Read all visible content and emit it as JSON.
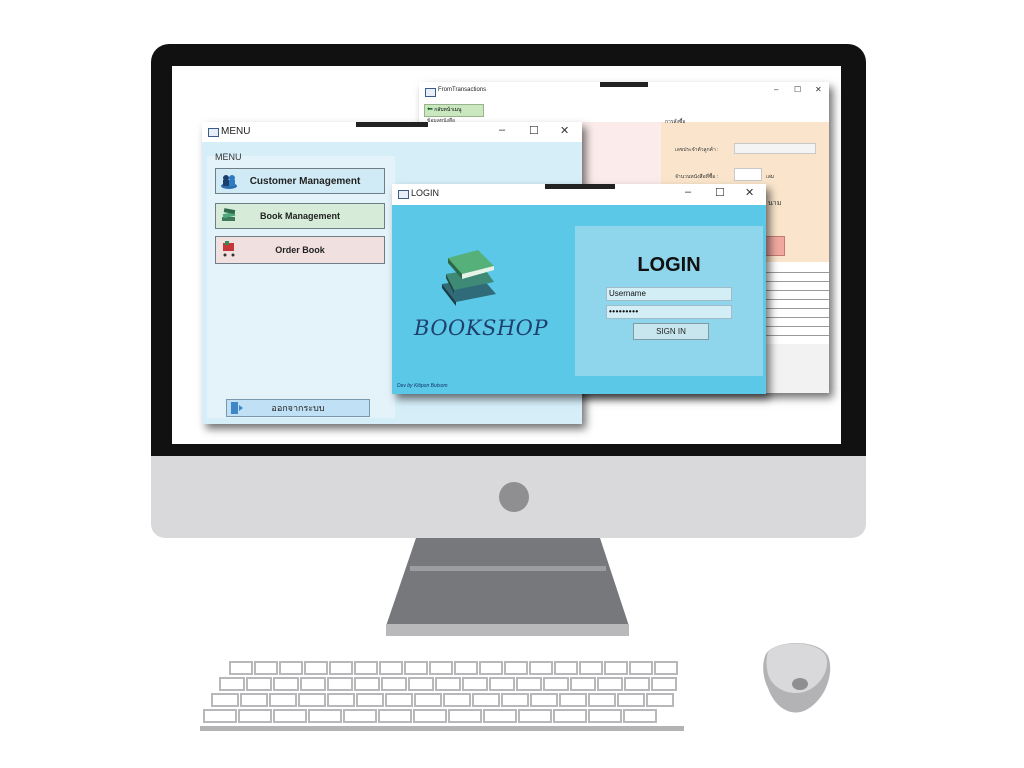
{
  "transactions_window": {
    "title": "FromTransactions",
    "back_button": "กลับหน้าเมนู",
    "panel_left_heading": "ข้อมูลหนังสือ",
    "panel_right_heading": "การสั่งซื้อ",
    "field_customer": "เลขประจำตัวลูกค้า :",
    "field_quantity": "จำนวนหนังสือที่ซื้อ :",
    "unit": "เล่ม",
    "fragment": "นาม"
  },
  "menu_window": {
    "title": "MENU",
    "group_label": "MENU",
    "buttons": [
      {
        "label": "Customer Management",
        "color": "#d0ebf6",
        "icon": "customers-icon"
      },
      {
        "label": "Book Management",
        "color": "#d6ecd9",
        "icon": "books-icon"
      },
      {
        "label": "Order Book",
        "color": "#f1e0e0",
        "icon": "cart-icon"
      }
    ],
    "logout_label": "ออกจากระบบ"
  },
  "login_window": {
    "title": "LOGIN",
    "heading": "LOGIN",
    "username_value": "Username",
    "password_value": "•••••••••",
    "signin_label": "SIGN IN",
    "logo_text": "BOOKSHOP",
    "credit": "Dev by Kitipon Butsom"
  },
  "window_controls": {
    "minimize": "–",
    "maximize": "☐",
    "close": "✕"
  },
  "colors": {
    "login_bg": "#5ac8e6",
    "login_panel": "#8fd6ec",
    "menu_bg": "#d6eef8"
  }
}
